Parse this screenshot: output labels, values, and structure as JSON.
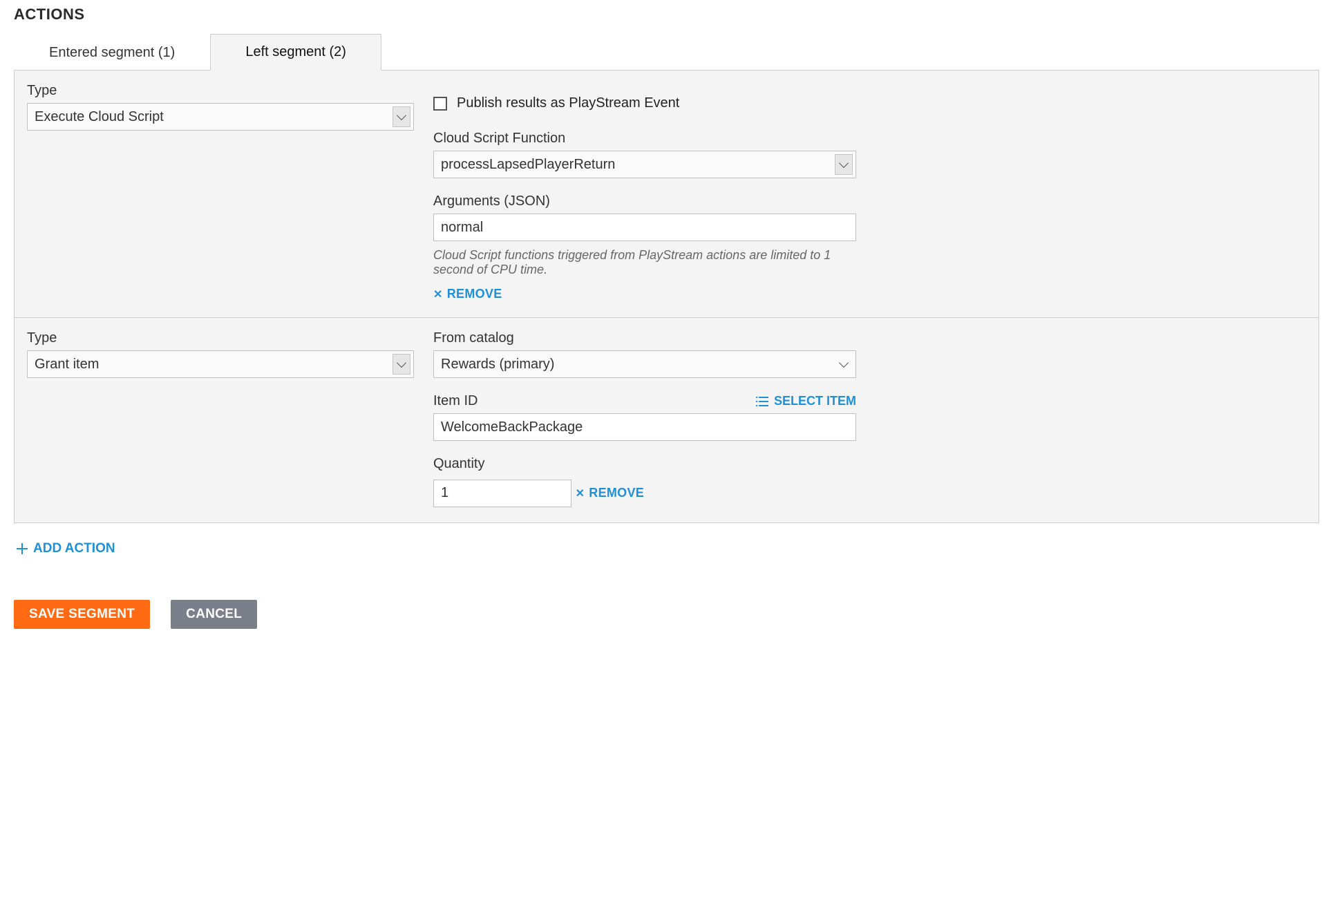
{
  "section_title": "ACTIONS",
  "tabs": {
    "entered": "Entered segment (1)",
    "left": "Left segment (2)"
  },
  "action1": {
    "type_label": "Type",
    "type_value": "Execute Cloud Script",
    "publish_label": "Publish results as PlayStream Event",
    "func_label": "Cloud Script Function",
    "func_value": "processLapsedPlayerReturn",
    "args_label": "Arguments (JSON)",
    "args_value": "normal",
    "hint": "Cloud Script functions triggered from PlayStream actions are limited to 1 second of CPU time.",
    "remove": "REMOVE"
  },
  "action2": {
    "type_label": "Type",
    "type_value": "Grant item",
    "catalog_label": "From catalog",
    "catalog_value": "Rewards (primary)",
    "item_label": "Item ID",
    "select_item": "SELECT ITEM",
    "item_value": "WelcomeBackPackage",
    "qty_label": "Quantity",
    "qty_value": "1",
    "remove": "REMOVE"
  },
  "add_action": "ADD ACTION",
  "buttons": {
    "save": "SAVE SEGMENT",
    "cancel": "CANCEL"
  }
}
